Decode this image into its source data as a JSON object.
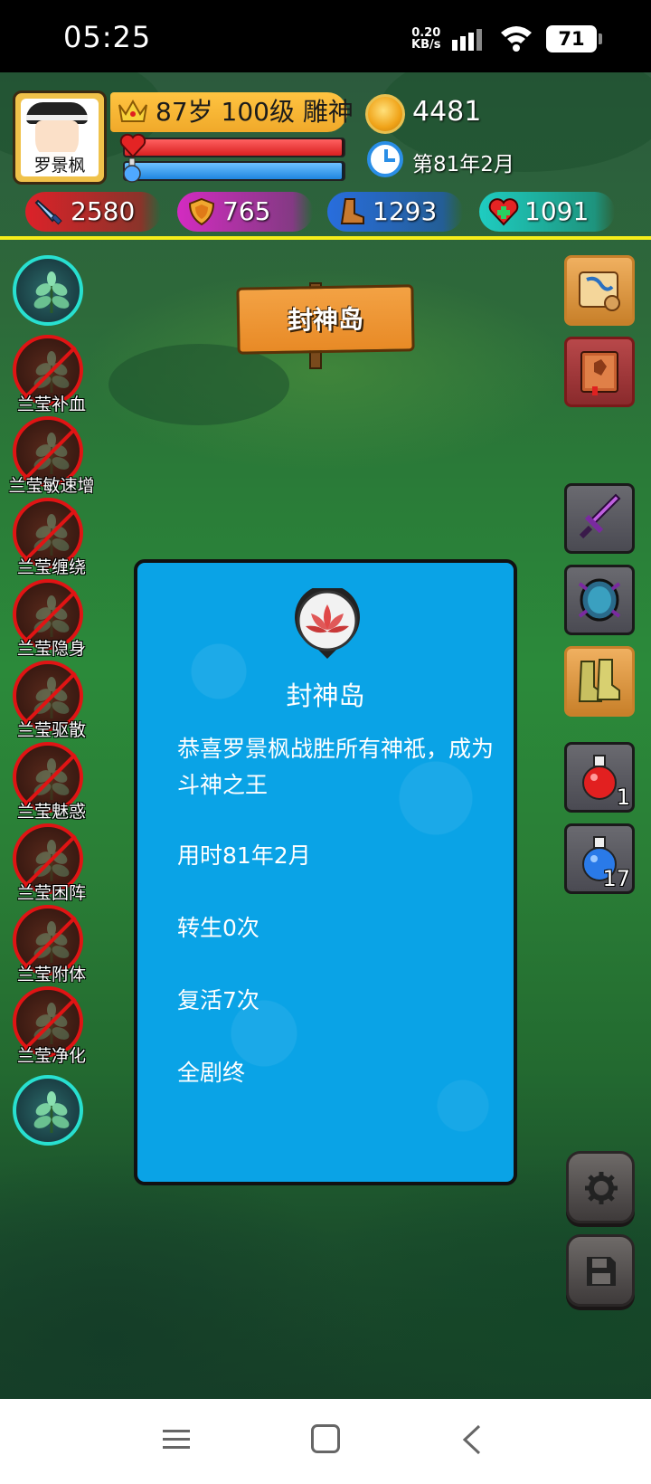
{
  "status_bar": {
    "time": "05:25",
    "net_speed_value": "0.20",
    "net_speed_unit": "KB/s",
    "battery": "71"
  },
  "player": {
    "name": "罗景枫",
    "level_info": "87岁 100级 雕神",
    "gold": "4481",
    "game_date": "第81年2月",
    "hp_fraction": 0.99,
    "mp_fraction": 0.99
  },
  "stats": {
    "attack": "2580",
    "defense": "765",
    "speed": "1293",
    "health": "1091"
  },
  "location_sign": "封神岛",
  "skills": [
    {
      "label": "",
      "state": "active"
    },
    {
      "label": "兰莹补血",
      "state": "locked"
    },
    {
      "label": "兰莹敏速增",
      "state": "locked"
    },
    {
      "label": "兰莹缠绕",
      "state": "locked"
    },
    {
      "label": "兰莹隐身",
      "state": "locked"
    },
    {
      "label": "兰莹驱散",
      "state": "locked"
    },
    {
      "label": "兰莹魅惑",
      "state": "locked"
    },
    {
      "label": "兰莹困阵",
      "state": "locked"
    },
    {
      "label": "兰莹附体",
      "state": "locked"
    },
    {
      "label": "兰莹净化",
      "state": "locked"
    },
    {
      "label": "",
      "state": "active"
    }
  ],
  "items": {
    "red_potion_count": "1",
    "blue_potion_count": "17"
  },
  "dialog": {
    "title": "封神岛",
    "message": "恭喜罗景枫战胜所有神祇，成为斗神之王",
    "time_used": "用时81年2月",
    "rebirth": "转生0次",
    "revive": "复活7次",
    "ending": "全剧终"
  },
  "colors": {
    "accent_yellow": "#f6ee1a",
    "dialog_bg": "#0aa3e6",
    "skill_active_ring": "#28e0d0",
    "skill_locked_ring": "#e01414"
  }
}
